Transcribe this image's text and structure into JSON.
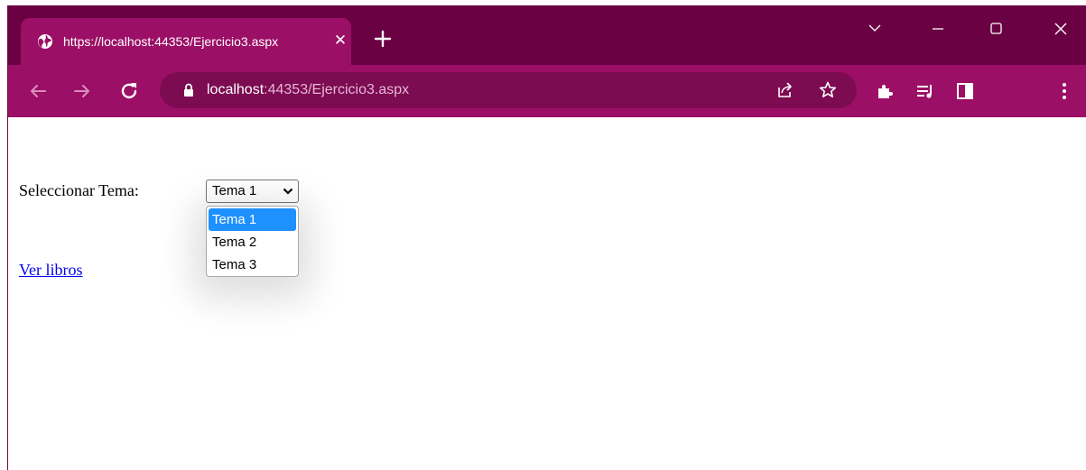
{
  "browser": {
    "tab": {
      "title": "https://localhost:44353/Ejercicio3.aspx",
      "close_glyph": "✕",
      "favicon": "globe-icon"
    },
    "new_tab_icon": "plus-icon",
    "window_controls": [
      "chevron-down-icon",
      "minimize-icon",
      "maximize-icon",
      "close-icon"
    ],
    "address_bar": {
      "host": "localhost",
      "rest": ":44353/Ejercicio3.aspx"
    },
    "toolbar_icons": [
      "back-icon",
      "forward-icon",
      "reload-icon",
      "lock-icon",
      "share-icon",
      "star-icon",
      "extensions-icon",
      "media-icon",
      "side-panel-icon",
      "menu-icon"
    ],
    "colors": {
      "frame": "#6a0142",
      "toolbar": "#9c0f66",
      "omnibox": "#7c0b52"
    }
  },
  "page": {
    "label": "Seleccionar Tema:",
    "select": {
      "value": "Tema 1",
      "options": [
        "Tema 1",
        "Tema 2",
        "Tema 3"
      ],
      "highlighted_index": 0
    },
    "link": "Ver libros"
  }
}
